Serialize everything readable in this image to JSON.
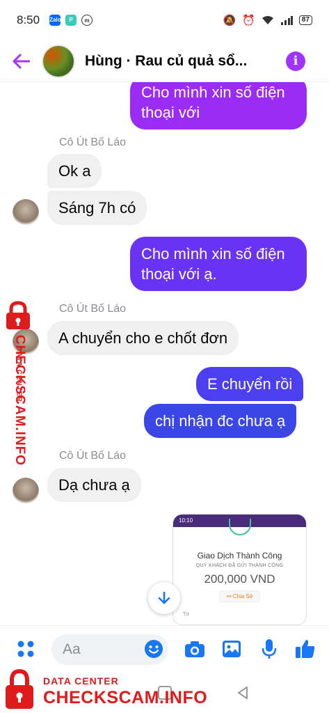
{
  "status_bar": {
    "time": "8:50",
    "battery": "87",
    "apps": [
      "Zalo",
      "P",
      "m"
    ]
  },
  "header": {
    "title": "Hùng · Rau củ quả sổ...",
    "info_label": "i"
  },
  "colors": {
    "accent": "#a033ff",
    "bubble_out_top": "#9b2cf5",
    "bubble_out_mid": "#6633f2",
    "bubble_out_bottom": "#3a47e6",
    "bubble_in": "#f0f0f0",
    "watermark": "#e01b1b"
  },
  "messages": {
    "m1": "Cho mình xin số điện thoại với",
    "s1": "Cô Út Bố Láo",
    "m2": "Ok a",
    "m3": "Sáng 7h có",
    "m4": "Cho mình xin số điện thoại với ạ.",
    "s2": "Cô Út Bố Láo",
    "m5": "A chuyển cho e chốt đơn",
    "m6": "E chuyển rồi",
    "m7": "chị nhận đc chưa ạ",
    "s3": "Cô Út Bố Láo",
    "m8": "Dạ chưa ạ"
  },
  "receipt": {
    "status_time": "10:10",
    "title": "Giao Dịch Thành Công",
    "subtitle": "QUÝ KHÁCH ĐÃ GỬI THÀNH CÔNG",
    "amount": "200,000 VND",
    "share": "Chia Sẻ",
    "from_label": "Từ"
  },
  "composer": {
    "placeholder": "Aa"
  },
  "watermark": {
    "small": "DATA CENTER",
    "big": "CHECKSCAM.INFO"
  }
}
